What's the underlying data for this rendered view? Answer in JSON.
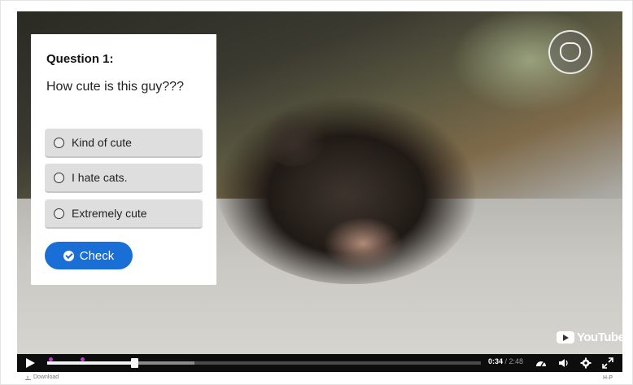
{
  "quiz": {
    "title": "Question 1:",
    "question": "How cute is this guy???",
    "options": [
      {
        "label": "Kind of cute"
      },
      {
        "label": "I hate cats."
      },
      {
        "label": "Extremely cute"
      }
    ],
    "check_label": "Check"
  },
  "player": {
    "current_time": "0:34",
    "duration": "2:48",
    "progress_fraction": 0.2,
    "buffer_fraction": 0.34,
    "youtube_label": "YouTube",
    "icons": [
      "play-icon",
      "speed-icon",
      "volume-icon",
      "settings-icon",
      "fullscreen-icon"
    ]
  },
  "footer": {
    "download_label": "Download",
    "h5p_label": "H-P"
  },
  "colors": {
    "accent": "#1a6fd6",
    "marker": "#c039c8",
    "option_bg": "#dedede"
  }
}
